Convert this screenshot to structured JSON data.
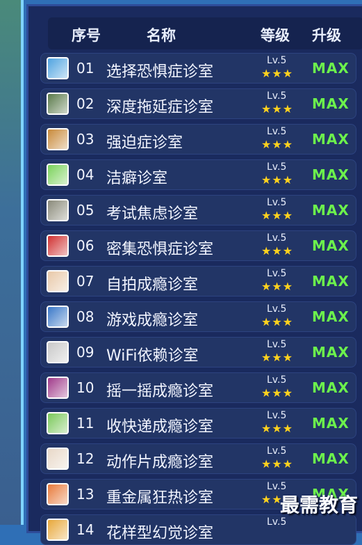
{
  "header": {
    "col_index": "序号",
    "col_name": "名称",
    "col_level": "等级",
    "col_upgrade": "升级"
  },
  "rows": [
    {
      "index": "01",
      "name": "选择恐惧症诊室",
      "level": "Lv.5",
      "stars": "★★★",
      "upgrade": "MAX",
      "icon_color": "#4fa3e0",
      "icon": "room-icon"
    },
    {
      "index": "02",
      "name": "深度拖延症诊室",
      "level": "Lv.5",
      "stars": "★★★",
      "upgrade": "MAX",
      "icon_color": "#5a7a4a",
      "icon": "room-icon"
    },
    {
      "index": "03",
      "name": "强迫症诊室",
      "level": "Lv.5",
      "stars": "★★★",
      "upgrade": "MAX",
      "icon_color": "#c88a3a",
      "icon": "room-icon"
    },
    {
      "index": "04",
      "name": "洁癖诊室",
      "level": "Lv.5",
      "stars": "★★★",
      "upgrade": "MAX",
      "icon_color": "#7ad25a",
      "icon": "room-icon"
    },
    {
      "index": "05",
      "name": "考试焦虑诊室",
      "level": "Lv.5",
      "stars": "★★★",
      "upgrade": "MAX",
      "icon_color": "#8a8a7a",
      "icon": "room-icon"
    },
    {
      "index": "06",
      "name": "密集恐惧症诊室",
      "level": "Lv.5",
      "stars": "★★★",
      "upgrade": "MAX",
      "icon_color": "#d03030",
      "icon": "room-icon"
    },
    {
      "index": "07",
      "name": "自拍成瘾诊室",
      "level": "Lv.5",
      "stars": "★★★",
      "upgrade": "MAX",
      "icon_color": "#e8c8a8",
      "icon": "room-icon"
    },
    {
      "index": "08",
      "name": "游戏成瘾诊室",
      "level": "Lv.5",
      "stars": "★★★",
      "upgrade": "MAX",
      "icon_color": "#3a78c8",
      "icon": "room-icon"
    },
    {
      "index": "09",
      "name": "WiFi依赖诊室",
      "level": "Lv.5",
      "stars": "★★★",
      "upgrade": "MAX",
      "icon_color": "#c8c8c8",
      "icon": "room-icon"
    },
    {
      "index": "10",
      "name": "摇一摇成瘾诊室",
      "level": "Lv.5",
      "stars": "★★★",
      "upgrade": "MAX",
      "icon_color": "#a03a8a",
      "icon": "room-icon"
    },
    {
      "index": "11",
      "name": "收快递成瘾诊室",
      "level": "Lv.5",
      "stars": "★★★",
      "upgrade": "MAX",
      "icon_color": "#7ac85a",
      "icon": "room-icon"
    },
    {
      "index": "12",
      "name": "动作片成瘾诊室",
      "level": "Lv.5",
      "stars": "★★★",
      "upgrade": "MAX",
      "icon_color": "#e8d8c8",
      "icon": "room-icon"
    },
    {
      "index": "13",
      "name": "重金属狂热诊室",
      "level": "Lv.5",
      "stars": "★★★",
      "upgrade": "MAX",
      "icon_color": "#e87a3a",
      "icon": "room-icon"
    },
    {
      "index": "14",
      "name": "花样型幻觉诊室",
      "level": "Lv.5",
      "stars": "",
      "upgrade": "",
      "icon_color": "#e8a83a",
      "icon": "room-icon"
    }
  ],
  "watermark": "最需教育"
}
